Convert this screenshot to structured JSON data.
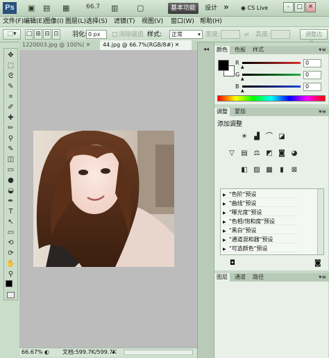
{
  "app": {
    "logo": "Ps",
    "zoom_value": "66.7",
    "workspace_basic": "基本功能",
    "workspace_design": "设计",
    "workspace_more": "»",
    "cs_live": "CS Live",
    "minimize": "–",
    "restore": "□",
    "close": "✕"
  },
  "menus": [
    "文件(F)",
    "编辑(E)",
    "图像(I)",
    "图层(L)",
    "选择(S)",
    "滤镜(T)",
    "视图(V)",
    "窗口(W)",
    "帮助(H)"
  ],
  "options": {
    "feather_label": "羽化:",
    "feather_value": "0 px",
    "antialias_label": "消除锯齿",
    "style_label": "样式:",
    "style_value": "正常",
    "width_label": "宽度:",
    "height_label": "高度:",
    "refine_edge": "调整边缘..."
  },
  "tools": [
    "move-tool",
    "marquee-tool",
    "lasso-tool",
    "quick-selection-tool",
    "crop-tool",
    "eyedropper-tool",
    "spot-healing-tool",
    "brush-tool",
    "clone-stamp-tool",
    "history-brush-tool",
    "eraser-tool",
    "gradient-tool",
    "blur-tool",
    "dodge-tool",
    "pen-tool",
    "type-tool",
    "path-selection-tool",
    "shape-tool",
    "3d-rotate-tool",
    "3d-camera-tool",
    "hand-tool",
    "zoom-tool"
  ],
  "documents": [
    {
      "title": "1220003.jpg @ 100%(",
      "active": false
    },
    {
      "title": "44.jpg @ 66.7%(RGB/8#)",
      "active": true
    }
  ],
  "status": {
    "zoom": "66.67%",
    "doc_info": "文档:599.7K/599.7K"
  },
  "color_panel": {
    "tabs": [
      "颜色",
      "色板",
      "样式"
    ],
    "active_tab": 0,
    "channels": [
      {
        "label": "R",
        "value": "0",
        "color": "#e03030"
      },
      {
        "label": "G",
        "value": "0",
        "color": "#20b040"
      },
      {
        "label": "B",
        "value": "0",
        "color": "#2040e0"
      }
    ],
    "foreground": "#000000",
    "background": "#ffffff"
  },
  "adjustments_panel": {
    "tabs": [
      "调整",
      "蒙版"
    ],
    "active_tab": 0,
    "title": "添加调整",
    "presets": [
      "\"色阶\"预设",
      "\"曲线\"预设",
      "\"曝光度\"预设",
      "\"色相/饱和度\"预设",
      "\"黑白\"预设",
      "\"通道混和器\"预设",
      "\"可选颜色\"预设"
    ]
  },
  "layers_panel": {
    "tabs": [
      "图层",
      "通道",
      "路径"
    ],
    "active_tab": 0
  }
}
